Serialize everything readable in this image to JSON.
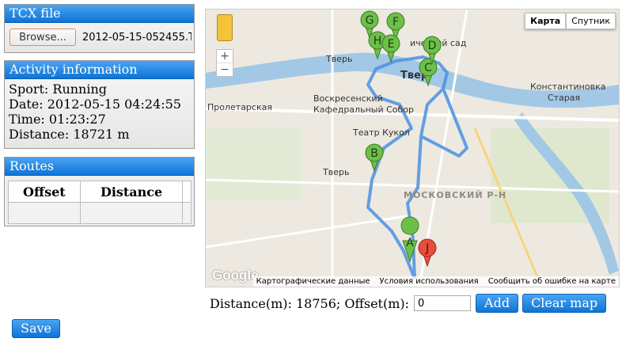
{
  "tcx": {
    "title": "TCX file",
    "browse_label": "Browse...",
    "file_name": "2012-05-15-052455.T"
  },
  "activity": {
    "title": "Activity information",
    "sport": "Sport: Running",
    "date": "Date: 2012-05-15 04:24:55",
    "time": "Time: 01:23:27",
    "distance": "Distance: 18721 m"
  },
  "routes": {
    "title": "Routes",
    "columns": [
      "Offset",
      "Distance"
    ]
  },
  "map": {
    "type_buttons": [
      "Карта",
      "Спутник"
    ],
    "zoom_in": "+",
    "zoom_out": "−",
    "logo": "Google",
    "footer": [
      "Картографические данные",
      "Условия использования",
      "Сообщить об ошибке на карте"
    ],
    "labels": {
      "tver_center": "Твер",
      "tver_left": "Тверь",
      "tver_mid": "Тверь",
      "proletarskaya": "Пролетарская",
      "cathedral_1": "Воскресенский",
      "cathedral_2": "Кафедральный Собор",
      "puppet_theater": "Театр Кукол",
      "district": "МОСКОВСКИЙ Р-Н",
      "konstantinovka_1": "Константиновка",
      "konstantinovka_2": "Старая",
      "garden": "ический сад"
    },
    "markers": [
      "A",
      "B",
      "C",
      "D",
      "E",
      "F",
      "G",
      "H",
      "J"
    ]
  },
  "controls": {
    "distance_text": "Distance(m): 18756; Offset(m):",
    "offset_value": "0",
    "add_label": "Add",
    "clear_label": "Clear map"
  },
  "save_label": "Save",
  "colors": {
    "accent": "#1a86e6",
    "route": "#4a90e2",
    "marker_green": "#6cc04a",
    "marker_red": "#e74c3c"
  }
}
